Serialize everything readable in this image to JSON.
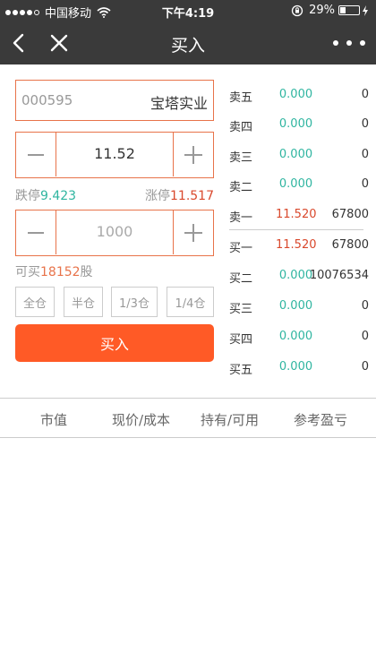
{
  "status_bar": {
    "carrier": "中国移动",
    "time": "下午4:19",
    "battery": "29%"
  },
  "nav": {
    "title": "买入"
  },
  "stock": {
    "code": "000595",
    "name": "宝塔实业"
  },
  "price_input": {
    "value": "11.52"
  },
  "limits": {
    "down_label": "跌停",
    "down_value": "9.423",
    "up_label": "涨停",
    "up_value": "11.517"
  },
  "qty_input": {
    "placeholder": "1000"
  },
  "can_buy": {
    "prefix": "可买",
    "value": "18152",
    "suffix": "股"
  },
  "quick_positions": [
    "全仓",
    "半仓",
    "1/3仓",
    "1/4仓"
  ],
  "buy_button": "买入",
  "order_book": [
    {
      "label": "卖五",
      "price": "0.000",
      "volume": "0",
      "color": "#2fb5a0"
    },
    {
      "label": "卖四",
      "price": "0.000",
      "volume": "0",
      "color": "#2fb5a0"
    },
    {
      "label": "卖三",
      "price": "0.000",
      "volume": "0",
      "color": "#2fb5a0"
    },
    {
      "label": "卖二",
      "price": "0.000",
      "volume": "0",
      "color": "#2fb5a0"
    },
    {
      "label": "卖一",
      "price": "11.520",
      "volume": "67800",
      "color": "#d9482c"
    },
    {
      "label": "买一",
      "price": "11.520",
      "volume": "67800",
      "color": "#d9482c"
    },
    {
      "label": "买二",
      "price": "0.000",
      "volume": "10076534",
      "color": "#2fb5a0"
    },
    {
      "label": "买三",
      "price": "0.000",
      "volume": "0",
      "color": "#2fb5a0"
    },
    {
      "label": "买四",
      "price": "0.000",
      "volume": "0",
      "color": "#2fb5a0"
    },
    {
      "label": "买五",
      "price": "0.000",
      "volume": "0",
      "color": "#2fb5a0"
    }
  ],
  "holdings_header": [
    "市值",
    "现价/成本",
    "持有/可用",
    "参考盈亏"
  ],
  "colors": {
    "accent": "#ff5a26",
    "border": "#e8734a",
    "green": "#2fb5a0",
    "red": "#d9482c",
    "nav_bg": "#3a3a3a"
  },
  "icons": {
    "back": "back-arrow-icon",
    "close": "close-icon",
    "more": "more-dots-icon",
    "wifi": "wifi-icon",
    "battery": "battery-icon",
    "lock": "rotation-lock-icon",
    "charging": "charging-icon"
  }
}
